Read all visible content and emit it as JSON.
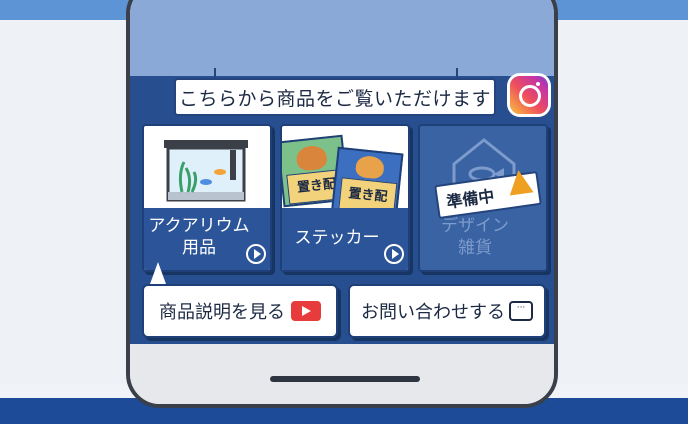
{
  "banner": {
    "text": "こちらから商品をご覧いただけます"
  },
  "cards": [
    {
      "label_line1": "アクアリウム",
      "label_line2": "用品"
    },
    {
      "label_line1": "ステッカー",
      "label_line2": ""
    },
    {
      "label_line1": "デザイン",
      "label_line2": "雑貨",
      "badge": "準備中"
    }
  ],
  "stickers": {
    "text_a": "置き配",
    "text_b": "置き配",
    "small_a": "チャイム押さず",
    "small_b": "不在時",
    "ok": "OKです"
  },
  "buttons": {
    "product_description": "商品説明を見る",
    "contact": "お問い合わせする"
  },
  "colors": {
    "accent": "#274e8f",
    "instagram": "#e4405f",
    "youtube": "#e83b3b",
    "badge_cone": "#f0a020"
  }
}
